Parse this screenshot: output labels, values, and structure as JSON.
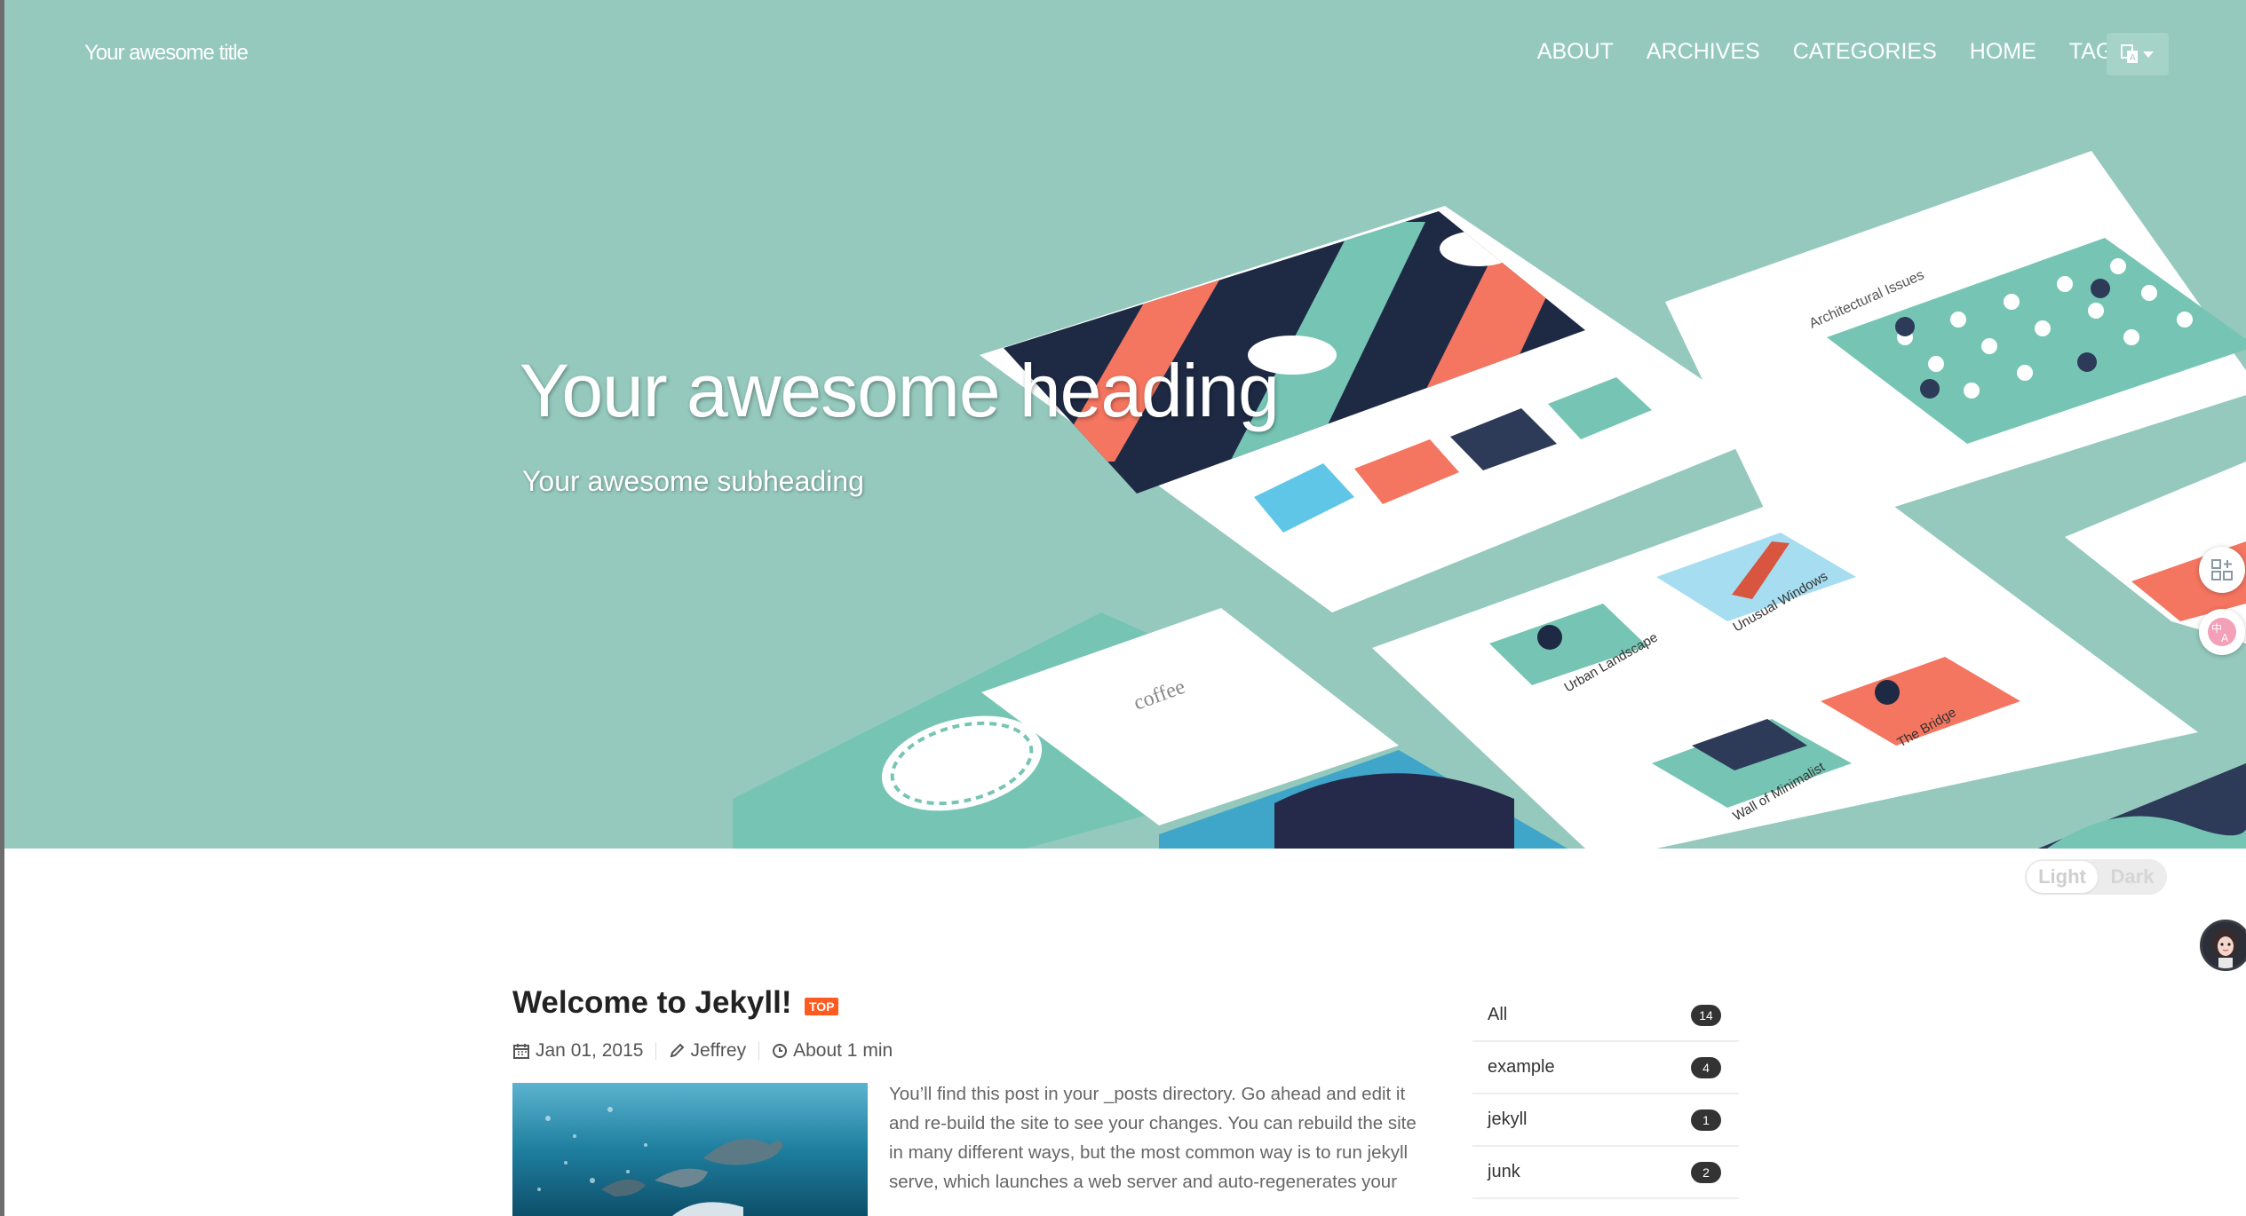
{
  "header": {
    "site_title": "Your awesome title",
    "nav": [
      "ABOUT",
      "ARCHIVES",
      "CATEGORIES",
      "HOME",
      "TAGS"
    ],
    "language_icon": "translate-icon"
  },
  "hero": {
    "heading": "Your awesome heading",
    "subheading": "Your awesome subheading",
    "mockup_labels": {
      "coffee": "coffee",
      "architectural": "Architectural Issues",
      "urban": "Urban Landscape",
      "windows": "Unusual Windows",
      "minimalist": "Wall of Minimalist",
      "bridge": "The Bridge"
    },
    "colors": {
      "background": "#95c9bd",
      "coral": "#f47560",
      "navy": "#1e2a44",
      "mint": "#76c5b4"
    }
  },
  "theme_toggle": {
    "light": "Light",
    "dark": "Dark"
  },
  "post": {
    "title": "Welcome to Jekyll!",
    "badge": "TOP",
    "date": "Jan 01, 2015",
    "author": "Jeffrey",
    "read_time": "About 1 min",
    "excerpt": "You’ll find this post in your _posts directory. Go ahead and edit it and re-build the site to see your changes. You can rebuild the site in many different ways, but the most common way is to run jekyll serve, which launches a web server and auto-regenerates your"
  },
  "sidebar": {
    "categories": [
      {
        "name": "All",
        "count": "14"
      },
      {
        "name": "example",
        "count": "4"
      },
      {
        "name": "jekyll",
        "count": "1"
      },
      {
        "name": "junk",
        "count": "2"
      }
    ]
  }
}
